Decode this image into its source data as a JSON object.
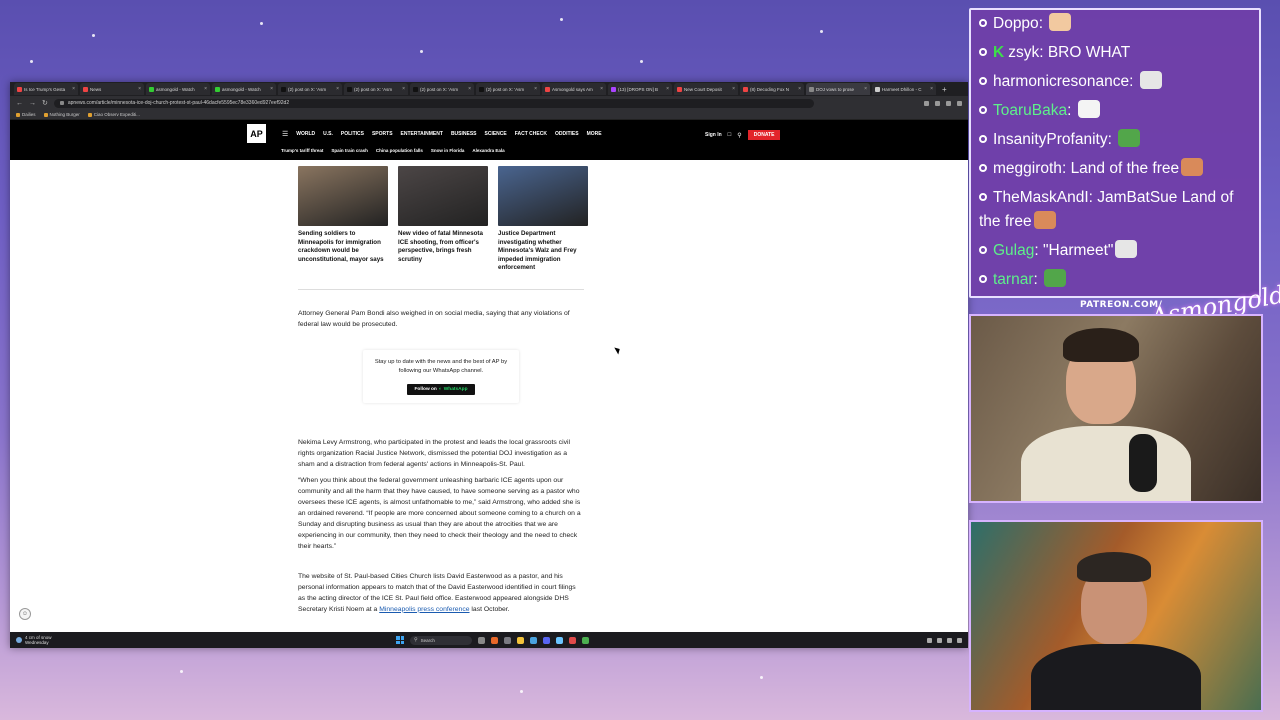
{
  "browser": {
    "tabs": [
      {
        "label": "Is Ice Trump's Gesta",
        "color": "#e44"
      },
      {
        "label": "News",
        "color": "#e44"
      },
      {
        "label": "asmongold - Watch",
        "color": "#3c3"
      },
      {
        "label": "asmongold - Watch",
        "color": "#3c3"
      },
      {
        "label": "(2) post on X: 'Asm",
        "color": "#111"
      },
      {
        "label": "(2) post on X: 'Asm",
        "color": "#111"
      },
      {
        "label": "(2) post on X: 'Asm",
        "color": "#111"
      },
      {
        "label": "(2) post on X: 'Asm",
        "color": "#111"
      },
      {
        "label": "Asmongold says Am",
        "color": "#e44"
      },
      {
        "label": "(13) [DROPS ON] B",
        "color": "#a4f"
      },
      {
        "label": "New Court Deposit",
        "color": "#e44"
      },
      {
        "label": "(8) Decoding Fox N",
        "color": "#e44"
      },
      {
        "label": "DOJ vows to prose",
        "color": "#888"
      },
      {
        "label": "Harmeet Dhillon - C",
        "color": "#ccc"
      }
    ],
    "active_tab_index": 12,
    "url": "apnews.com/article/minnesota-ice-doj-church-protest-st-paul-46dacfe5595ec78e3360ed927eef92d2",
    "bookmarks": [
      "Dailies",
      "Nothing Burger",
      "Ciao Observ Expediti..."
    ]
  },
  "ap": {
    "logo": "AP",
    "nav": [
      "WORLD",
      "U.S.",
      "POLITICS",
      "SPORTS",
      "ENTERTAINMENT",
      "BUSINESS",
      "SCIENCE",
      "FACT CHECK",
      "ODDITIES",
      "MORE"
    ],
    "signin": "Sign In",
    "donate": "DONATE",
    "trending": [
      "Trump's tariff threat",
      "Spain train crash",
      "China population falls",
      "Snow in Florida",
      "Alexandra Eala"
    ]
  },
  "article": {
    "cards": [
      {
        "title": "Sending soldiers to Minneapolis for immigration crackdown would be unconstitutional, mayor says",
        "thumb": "#8a7560"
      },
      {
        "title": "New video of fatal Minnesota ICE shooting, from officer's perspective, brings fresh scrutiny",
        "thumb": "#4c4646"
      },
      {
        "title": "Justice Department investigating whether Minnesota's Walz and Frey impeded immigration enforcement",
        "thumb": "#4a6590"
      }
    ],
    "para1": "Attorney General Pam Bondi also weighed in on social media, saying that any violations of federal law would be prosecuted.",
    "whatsapp": {
      "text": "Stay up to date with the news and the best of AP by following our WhatsApp channel.",
      "button": "Follow on",
      "button_brand": "WhatsApp"
    },
    "para2": "Nekima Levy Armstrong, who participated in the protest and leads the local grassroots civil rights organization Racial Justice Network, dismissed the potential DOJ investigation as a sham and a distraction from federal agents' actions in Minneapolis-St. Paul.",
    "para3": "“When you think about the federal government unleashing barbaric ICE agents upon our community and all the harm that they have caused, to have someone serving as a pastor who oversees these ICE agents, is almost unfathomable to me,” said Armstrong, who added she is an ordained reverend. “If people are more concerned about someone coming to a church on a Sunday and disrupting business as usual than they are about the atrocities that we are experiencing in our community, then they need to check their theology and the need to check their hearts.”",
    "para4_start": "The website of St. Paul-based Cities Church lists David Easterwood as a pastor, and his personal information appears to match that of the David Easterwood identified in court filings as the acting director of the ICE St. Paul field office. Easterwood appeared alongside DHS Secretary Kristi Noem at a ",
    "para4_link": "Minneapolis press conference",
    "para4_end": " last October."
  },
  "taskbar": {
    "weather_temp": "4 cm of snow",
    "weather_day": "Wednesday",
    "search": "Search"
  },
  "chat": {
    "messages": [
      {
        "user": "Doppo",
        "user_color": "#ffffff",
        "text": "",
        "emote": "#f2c9a0",
        "badge": ""
      },
      {
        "user": "zsyk",
        "user_color": "#ffffff",
        "text": "BRO WHAT",
        "emote": "",
        "badge": "K"
      },
      {
        "user": "harmonicresonance",
        "user_color": "#ffffff",
        "text": "",
        "emote": "#e6e6e6",
        "badge": ""
      },
      {
        "user": "ToaruBaka",
        "user_color": "#5ef08a",
        "text": "",
        "emote": "#f4f4f4",
        "badge": ""
      },
      {
        "user": "InsanityProfanity",
        "user_color": "#ffffff",
        "text": "",
        "emote": "#52a64a",
        "badge": ""
      },
      {
        "user": "meggiroth",
        "user_color": "#ffffff",
        "text": "Land of the free",
        "emote": "#d98a5a",
        "badge": ""
      },
      {
        "user": "TheMaskAndI",
        "user_color": "#ffffff",
        "text": "JamBatSue Land of the free",
        "emote": "#d98a5a",
        "badge": ""
      },
      {
        "user": "Gulag",
        "user_color": "#5ef08a",
        "text": "\"Harmeet\"",
        "emote": "#e6e6e6",
        "badge": ""
      },
      {
        "user": "tarnar",
        "user_color": "#5ef08a",
        "text": "",
        "emote": "#52a64a",
        "badge": ""
      }
    ]
  },
  "overlay": {
    "patreon": "PATREON.COM/",
    "signature": "Asmongold"
  }
}
